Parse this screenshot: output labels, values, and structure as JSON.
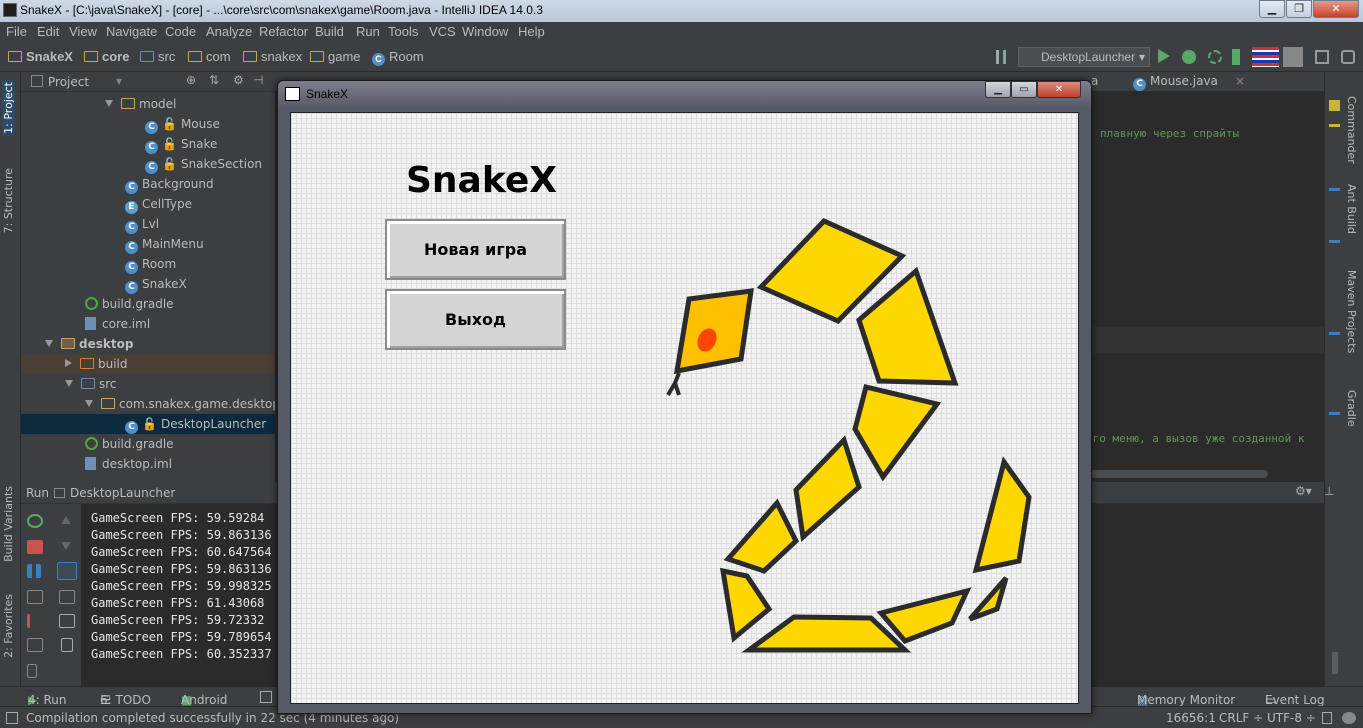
{
  "window": {
    "title": "SnakeX - [C:\\java\\SnakeX] - [core] - ...\\core\\src\\com\\snakex\\game\\Room.java - IntelliJ IDEA 14.0.3",
    "controls": [
      "▁",
      "❐",
      "✕"
    ]
  },
  "menu": [
    "File",
    "Edit",
    "View",
    "Navigate",
    "Code",
    "Analyze",
    "Refactor",
    "Build",
    "Run",
    "Tools",
    "VCS",
    "Window",
    "Help"
  ],
  "breadcrumbs": [
    "SnakeX",
    "core",
    "src",
    "com",
    "snakex",
    "game",
    "Room"
  ],
  "run_config": "DesktopLauncher",
  "project_panel": {
    "title": "Project",
    "tree": [
      {
        "label": "model",
        "type": "folder",
        "level": 4,
        "expanded": true
      },
      {
        "label": "Mouse",
        "type": "class",
        "level": 6
      },
      {
        "label": "Snake",
        "type": "class",
        "level": 6
      },
      {
        "label": "SnakeSection",
        "type": "class",
        "level": 6
      },
      {
        "label": "Background",
        "type": "class",
        "level": 5
      },
      {
        "label": "CellType",
        "type": "enum",
        "level": 5
      },
      {
        "label": "Lvl",
        "type": "class",
        "level": 5
      },
      {
        "label": "MainMenu",
        "type": "class",
        "level": 5
      },
      {
        "label": "Room",
        "type": "class",
        "level": 5
      },
      {
        "label": "SnakeX",
        "type": "class",
        "level": 5
      },
      {
        "label": "build.gradle",
        "type": "gradle",
        "level": 3
      },
      {
        "label": "core.iml",
        "type": "iml",
        "level": 3
      },
      {
        "label": "desktop",
        "type": "folder-bold",
        "level": 1,
        "expanded": true
      },
      {
        "label": "build",
        "type": "folder-orange",
        "level": 2,
        "expanded": false
      },
      {
        "label": "src",
        "type": "folder",
        "level": 2,
        "expanded": true
      },
      {
        "label": "com.snakex.game.desktop",
        "type": "folder",
        "level": 3,
        "expanded": true
      },
      {
        "label": "DesktopLauncher",
        "type": "class",
        "level": 5,
        "selected": true
      },
      {
        "label": "build.gradle",
        "type": "gradle",
        "level": 3
      },
      {
        "label": "desktop.iml",
        "type": "iml",
        "level": 3
      }
    ]
  },
  "editor": {
    "tabs": [
      "a",
      "Mouse.java"
    ],
    "comment_1": "плавную через спрайты",
    "comment_2": "ого меню, а вызов уже созданной к"
  },
  "left_tool_tabs": [
    "1: Project",
    "7: Structure",
    "Build Variants",
    "2: Favorites"
  ],
  "right_tool_tabs": [
    "Commander",
    "Ant Build",
    "Maven Projects",
    "Gradle"
  ],
  "run_panel": {
    "title": "Run",
    "config": "DesktopLauncher",
    "lines": [
      "GameScreen FPS: 59.59284",
      "GameScreen FPS: 59.863136",
      "GameScreen FPS: 60.647564",
      "GameScreen FPS: 59.863136",
      "GameScreen FPS: 59.998325",
      "GameScreen FPS: 61.43068",
      "GameScreen FPS: 59.72332",
      "GameScreen FPS: 59.789654",
      "GameScreen FPS: 60.352337"
    ]
  },
  "bottom_tabs": {
    "run": "4: Run",
    "todo": "6: TODO",
    "android": "Android",
    "memory": "Memory Monitor",
    "eventlog": "Event Log"
  },
  "status": {
    "message": "Compilation completed successfully in 22 sec (4 minutes ago)",
    "position": "16656:1",
    "line_sep": "CRLF ÷",
    "encoding": "UTF-8 ÷"
  },
  "game_window": {
    "title": "SnakeX",
    "logo": "SnakeX",
    "menu_buttons": [
      "Новая игра",
      "Выход"
    ],
    "snake_colors": {
      "body": "#ffd700",
      "head": "#ffc000",
      "outline": "#2b2b2b",
      "eye": "#ff4500"
    }
  }
}
